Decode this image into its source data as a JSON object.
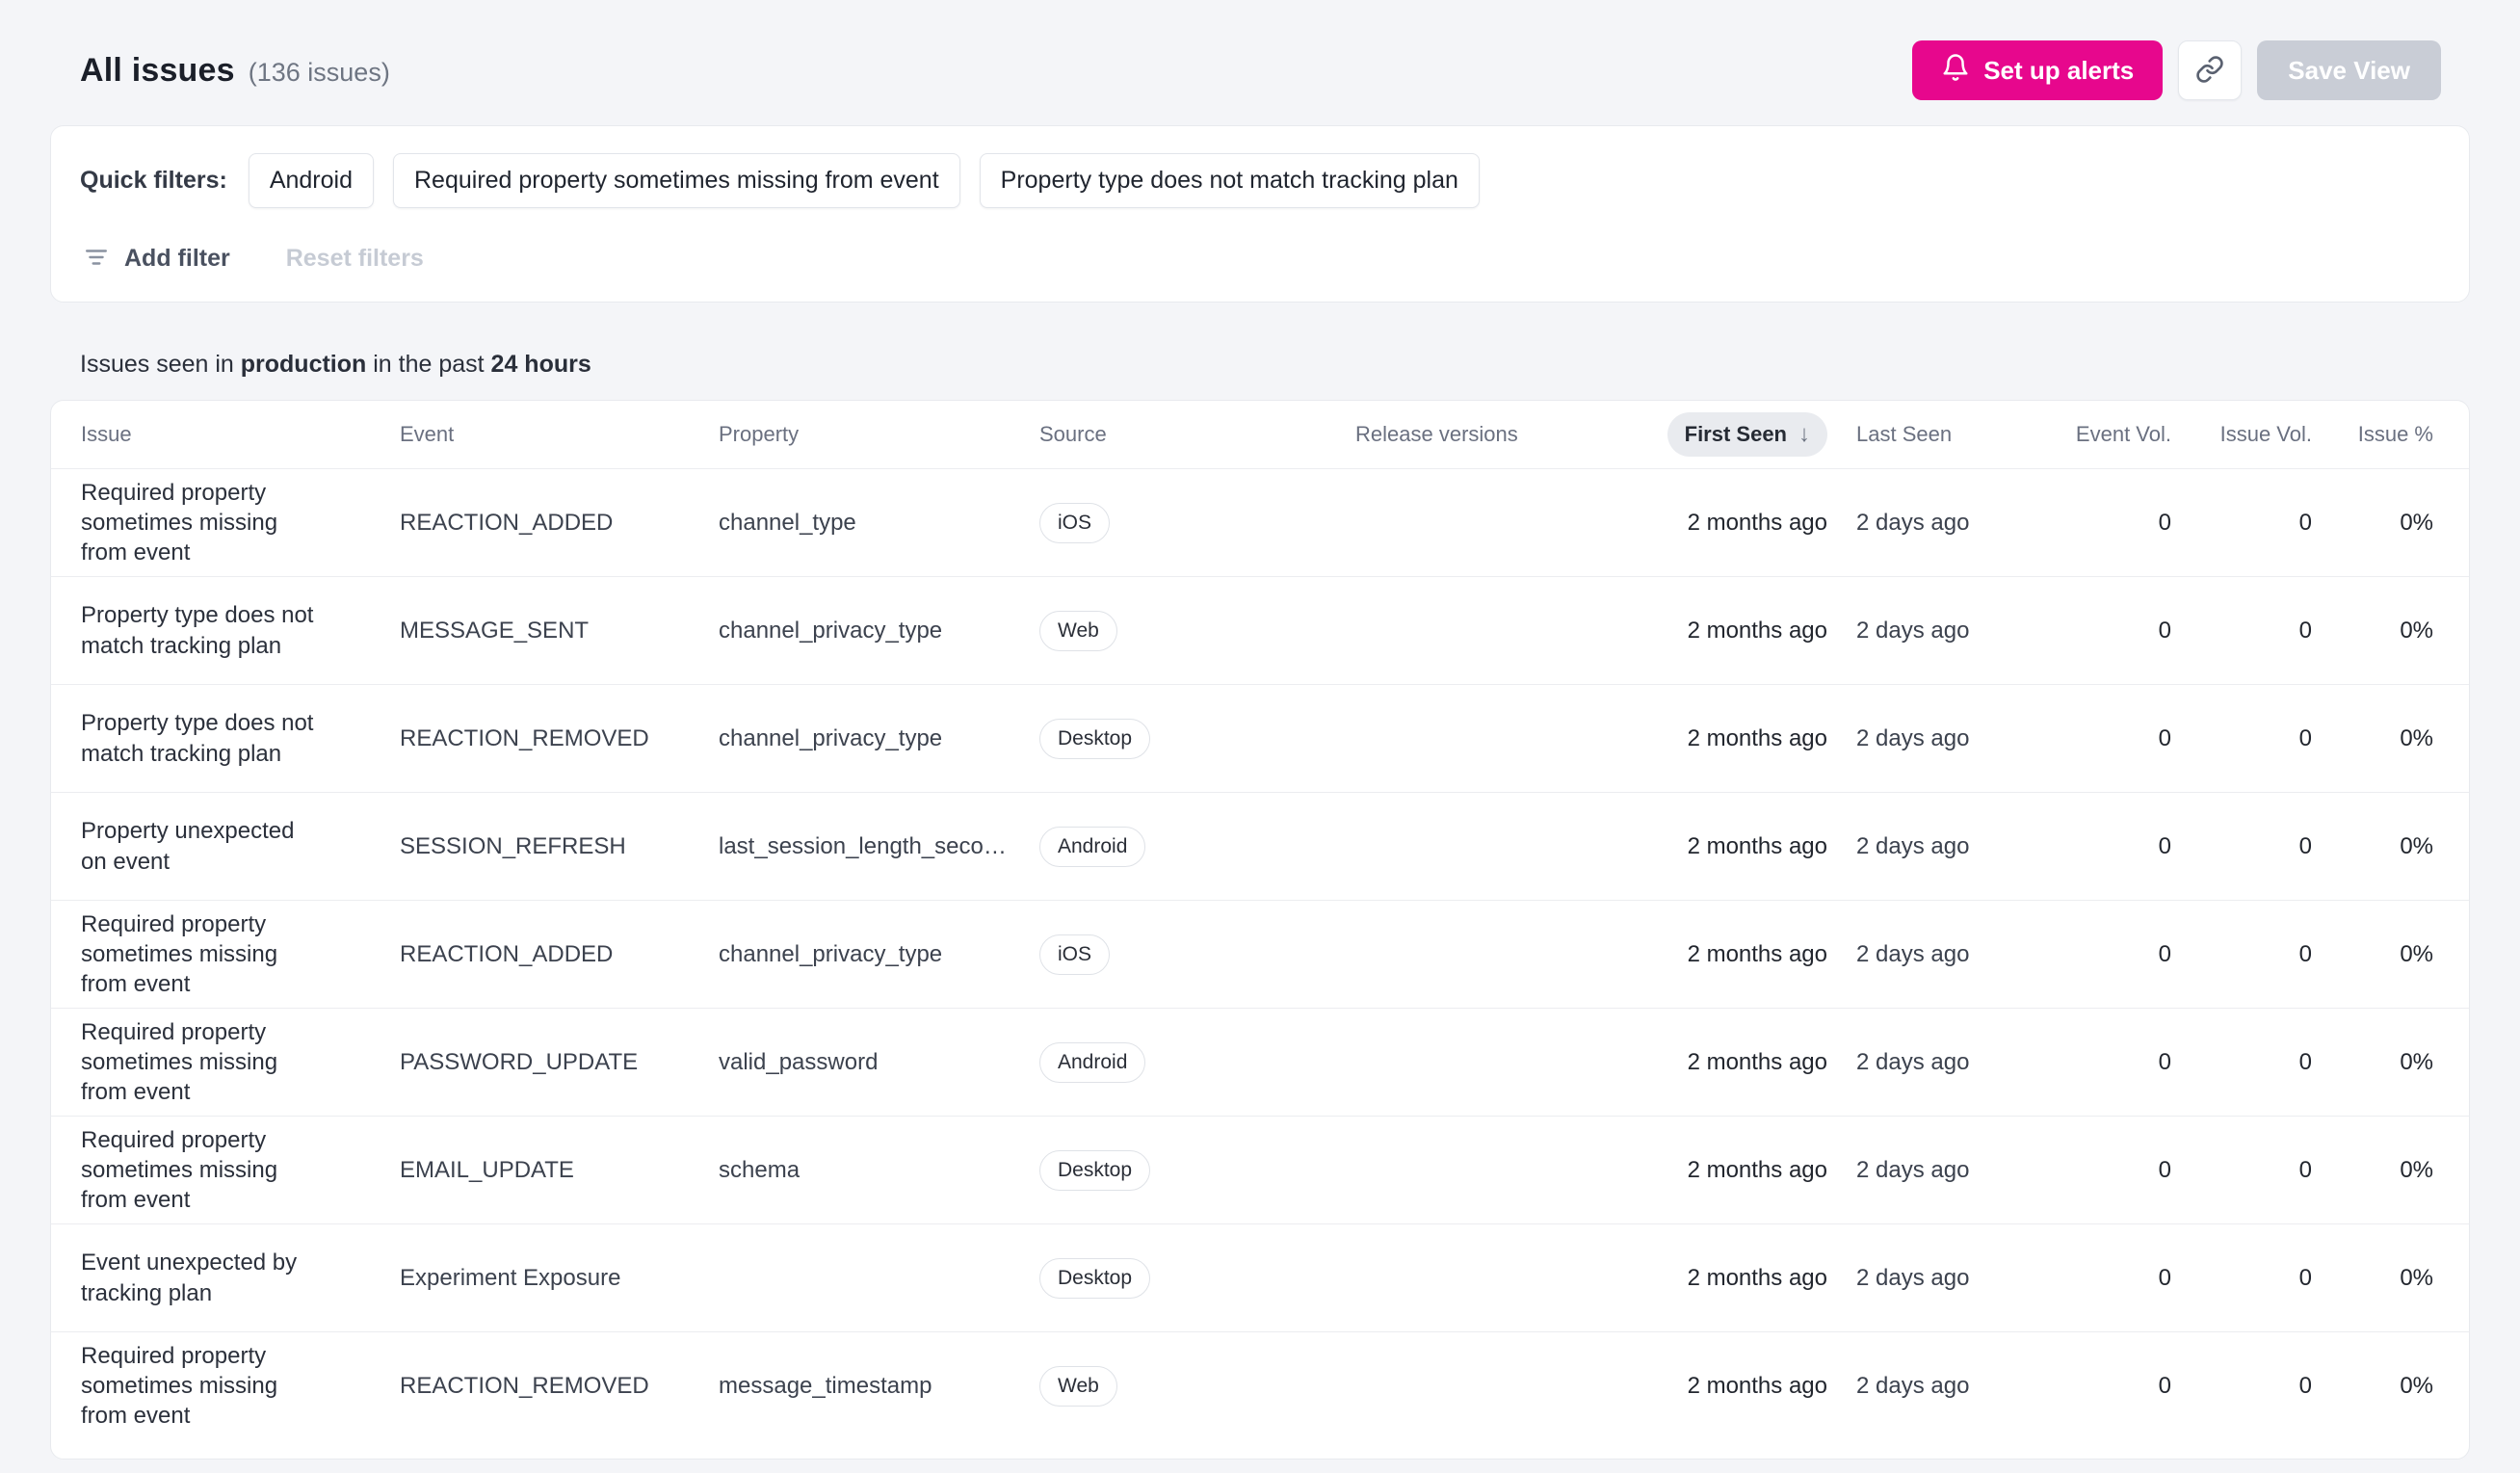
{
  "page": {
    "title": "All issues",
    "issue_count": "(136 issues)"
  },
  "header_actions": {
    "set_up_alerts_label": "Set up alerts",
    "save_view_label": "Save View",
    "icons": {
      "alerts": "bell-icon",
      "share": "link-icon"
    },
    "colors": {
      "accent_pink": "#E7078D",
      "save_view_disabled_bg": "#C9CDD6"
    }
  },
  "filters": {
    "label": "Quick filters:",
    "chips": [
      "Android",
      "Required property sometimes missing from event",
      "Property type does not match tracking plan"
    ],
    "add_filter_label": "Add filter",
    "reset_filters_label": "Reset filters",
    "icons": {
      "add_filter": "filter-lines-icon"
    }
  },
  "status_line": {
    "prefix": "Issues seen in ",
    "environment": "production",
    "middle": " in the past ",
    "time_range": "24 hours"
  },
  "table": {
    "headers": [
      "Issue",
      "Event",
      "Property",
      "Source",
      "Release versions",
      "First Seen",
      "Last Seen",
      "Event Vol.",
      "Issue Vol.",
      "Issue %"
    ],
    "sort": {
      "column": "First Seen",
      "direction_icon": "↓",
      "pill_bg": "#E9EBEF"
    },
    "rows": [
      {
        "issue": "Required property sometimes missing from event",
        "event": "REACTION_ADDED",
        "property": "channel_type",
        "source": "iOS",
        "release_versions": "",
        "first_seen": "2 months ago",
        "last_seen": "2 days ago",
        "event_vol": "0",
        "issue_vol": "0",
        "issue_pct": "0%"
      },
      {
        "issue": "Property type does not match tracking plan",
        "event": "MESSAGE_SENT",
        "property": "channel_privacy_type",
        "source": "Web",
        "release_versions": "",
        "first_seen": "2 months ago",
        "last_seen": "2 days ago",
        "event_vol": "0",
        "issue_vol": "0",
        "issue_pct": "0%"
      },
      {
        "issue": "Property type does not match tracking plan",
        "event": "REACTION_REMOVED",
        "property": "channel_privacy_type",
        "source": "Desktop",
        "release_versions": "",
        "first_seen": "2 months ago",
        "last_seen": "2 days ago",
        "event_vol": "0",
        "issue_vol": "0",
        "issue_pct": "0%"
      },
      {
        "issue": "Property unexpected on event",
        "event": "SESSION_REFRESH",
        "property": "last_session_length_secon...",
        "source": "Android",
        "release_versions": "",
        "first_seen": "2 months ago",
        "last_seen": "2 days ago",
        "event_vol": "0",
        "issue_vol": "0",
        "issue_pct": "0%"
      },
      {
        "issue": "Required property sometimes missing from event",
        "event": "REACTION_ADDED",
        "property": "channel_privacy_type",
        "source": "iOS",
        "release_versions": "",
        "first_seen": "2 months ago",
        "last_seen": "2 days ago",
        "event_vol": "0",
        "issue_vol": "0",
        "issue_pct": "0%"
      },
      {
        "issue": "Required property sometimes missing from event",
        "event": "PASSWORD_UPDATE",
        "property": "valid_password",
        "source": "Android",
        "release_versions": "",
        "first_seen": "2 months ago",
        "last_seen": "2 days ago",
        "event_vol": "0",
        "issue_vol": "0",
        "issue_pct": "0%"
      },
      {
        "issue": "Required property sometimes missing from event",
        "event": "EMAIL_UPDATE",
        "property": "schema",
        "source": "Desktop",
        "release_versions": "",
        "first_seen": "2 months ago",
        "last_seen": "2 days ago",
        "event_vol": "0",
        "issue_vol": "0",
        "issue_pct": "0%"
      },
      {
        "issue": "Event unexpected by tracking plan",
        "event": "Experiment Exposure",
        "property": "",
        "source": "Desktop",
        "release_versions": "",
        "first_seen": "2 months ago",
        "last_seen": "2 days ago",
        "event_vol": "0",
        "issue_vol": "0",
        "issue_pct": "0%"
      },
      {
        "issue": "Required property sometimes missing from event",
        "event": "REACTION_REMOVED",
        "property": "message_timestamp",
        "source": "Web",
        "release_versions": "",
        "first_seen": "2 months ago",
        "last_seen": "2 days ago",
        "event_vol": "0",
        "issue_vol": "0",
        "issue_pct": "0%"
      }
    ]
  }
}
